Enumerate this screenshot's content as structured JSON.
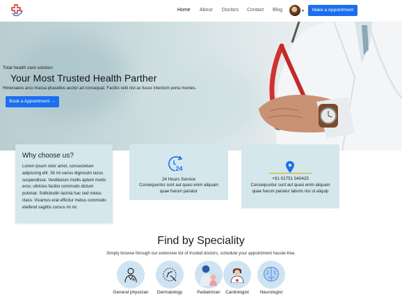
{
  "nav": {
    "links": [
      "Home",
      "About",
      "Doctors",
      "Contact",
      "Blog"
    ],
    "active": "Home",
    "cta_label": "Make a Appointment"
  },
  "hero": {
    "kicker": "Total health care solution",
    "title": "Your Most Trusted Health Parther",
    "subtitle": "Himenaeos arcu massa phasellus auctor ad consequat. Facilisi velit nisl ac fusce interdum porta montes.",
    "cta_label": "Book a Appointment →"
  },
  "why": {
    "title": "Why choose us?",
    "body": "Lorem ipsum odor amet, consectetuer adipiscing elit. Sit mi varius dignissim lacus suspendisse. Vestibulum mollis aptent morbi eros; ultricies facilisi commodo dictum pulvinar. Sollicitudin lacinia hac sed metus class. Vivamus erat efficitur metus commodo eleifend sagittis cursus mi mi."
  },
  "service": {
    "icon": "clock-24-icon",
    "heading": "24 Hours Service",
    "text": "Consequuntur sunt aut quasi enim aliquam quae harum pariatur"
  },
  "contact": {
    "icon": "location-pin-icon",
    "phone": "+91 01751 040425",
    "text": "Consequuntur sunt aut quasi enim aliquam quae harum pariatur laboris nisi ut aliquip"
  },
  "speciality": {
    "title": "Find by Speciality",
    "subtitle": "Simply browse through our extensive list of trusted doctors, schedule your appointment hassle-free.",
    "items": [
      {
        "label": "General physician",
        "icon": "physician-icon"
      },
      {
        "label": "Dermatology",
        "icon": "dermatology-icon"
      },
      {
        "label": "Pediatrician",
        "icon": "pediatrician-icon"
      },
      {
        "label": "Cardiologist",
        "icon": "cardiologist-icon"
      },
      {
        "label": "Neurologist",
        "icon": "brain-icon"
      }
    ]
  },
  "colors": {
    "primary": "#1a6ff0",
    "card_bg": "#d4e7ec",
    "icon_circle": "#cfe4f3"
  }
}
